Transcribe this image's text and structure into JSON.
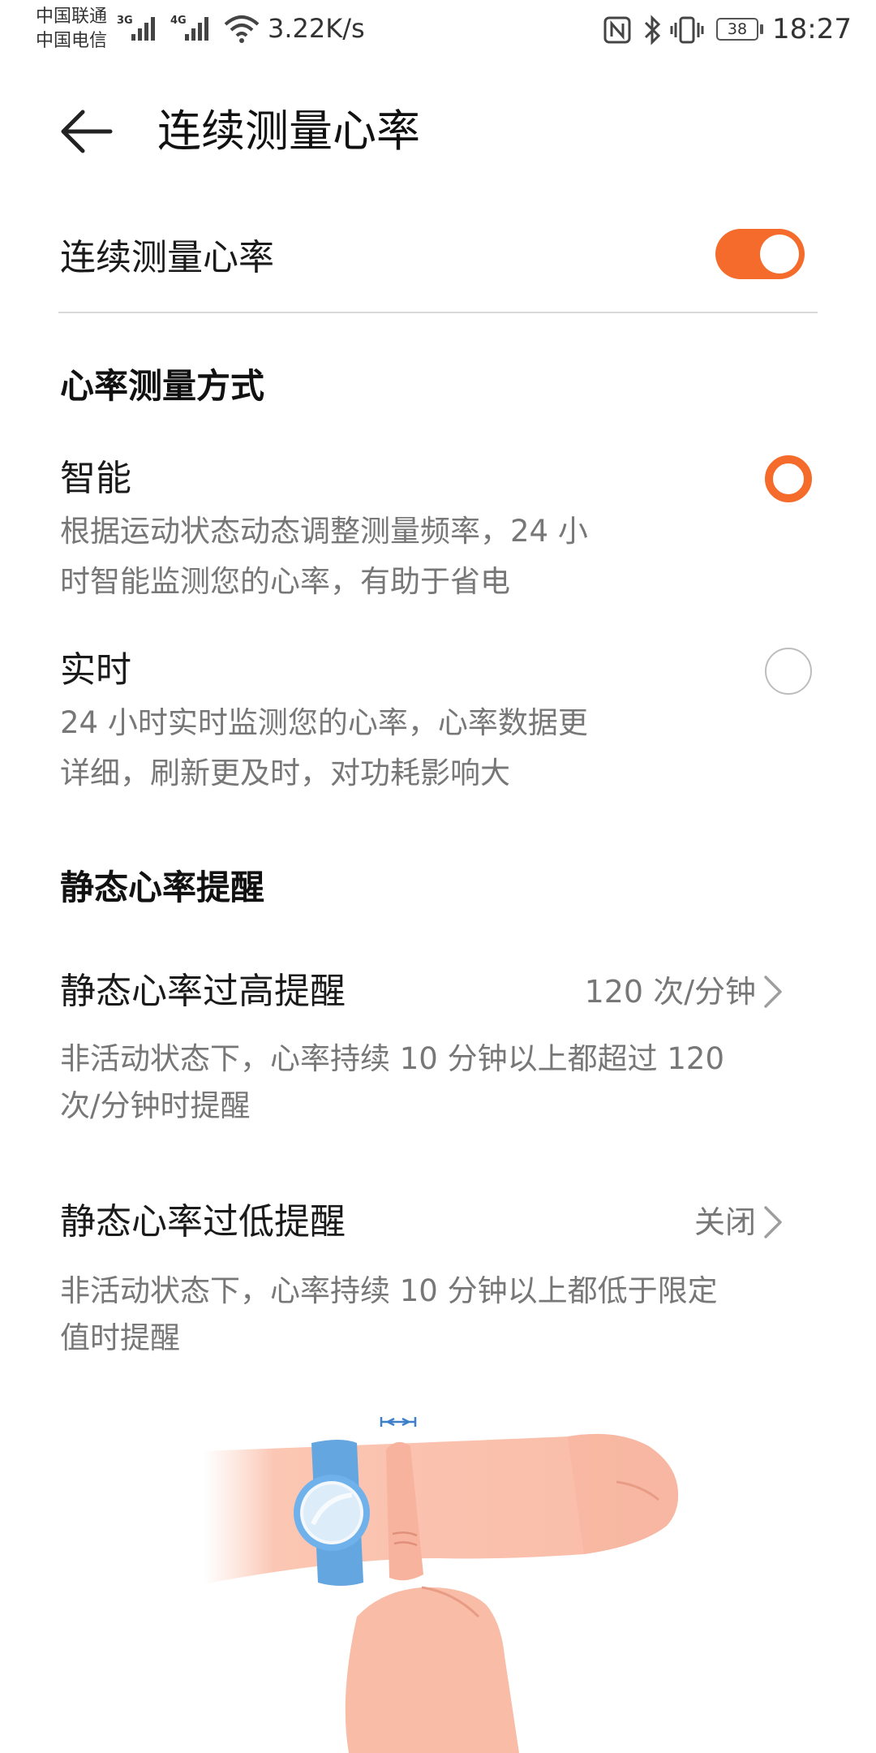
{
  "status_bar": {
    "carrier_1": "中国联通",
    "carrier_2": "中国电信",
    "network_1": "3G",
    "network_2": "4G",
    "speed": "3.22K/s",
    "battery": "38",
    "time": "18:27",
    "icons": [
      "signal-icon",
      "wifi-icon",
      "nfc-icon",
      "bluetooth-icon",
      "vibrate-icon",
      "battery-icon"
    ]
  },
  "header": {
    "title": "连续测量心率",
    "back_icon": "back-arrow-icon"
  },
  "continuous": {
    "label": "连续测量心率",
    "enabled": true,
    "accent_color": "#f56b2b"
  },
  "mode_section": {
    "header": "心率测量方式",
    "options": [
      {
        "title": "智能",
        "desc_line1": "根据运动状态动态调整测量频率，24 小",
        "desc_line2": "时智能监测您的心率，有助于省电",
        "selected": true
      },
      {
        "title": "实时",
        "desc_line1": "24 小时实时监测您的心率，心率数据更",
        "desc_line2": "详细，刷新更及时，对功耗影响大",
        "selected": false
      }
    ]
  },
  "alert_section": {
    "header": "静态心率提醒",
    "high": {
      "title": "静态心率过高提醒",
      "value": "120 次/分钟",
      "desc_line1": "非活动状态下，心率持续 10 分钟以上都超过 120",
      "desc_line2": "次/分钟时提醒"
    },
    "low": {
      "title": "静态心率过低提醒",
      "value": "关闭",
      "desc_line1": "非活动状态下，心率持续 10 分钟以上都低于限定",
      "desc_line2": "值时提醒"
    }
  }
}
